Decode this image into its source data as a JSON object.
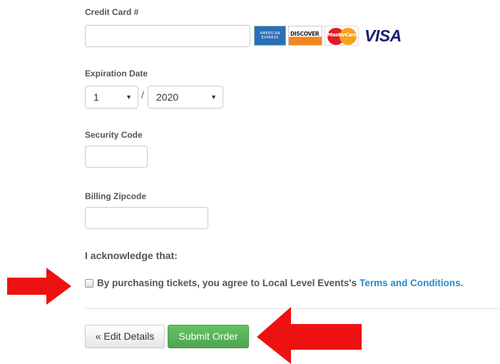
{
  "credit_card": {
    "label": "Credit Card #",
    "value": "",
    "card_logos": {
      "amex": "AMERICAN EXPRESS",
      "discover": "DISCOVER",
      "mastercard": "MasterCard",
      "visa": "VISA"
    }
  },
  "expiration": {
    "label": "Expiration Date",
    "month": "1",
    "separator": "/",
    "year": "2020"
  },
  "security_code": {
    "label": "Security Code",
    "value": ""
  },
  "billing_zip": {
    "label": "Billing Zipcode",
    "value": ""
  },
  "acknowledge": {
    "heading": "I acknowledge that:",
    "text": "By purchasing tickets, you agree to Local Level Events's",
    "link": "Terms and Conditions."
  },
  "buttons": {
    "edit": "« Edit Details",
    "submit": "Submit Order"
  },
  "colors": {
    "arrow": "#ee1111",
    "submit_green": "#5cb85c",
    "link_blue": "#2a8ac9"
  }
}
